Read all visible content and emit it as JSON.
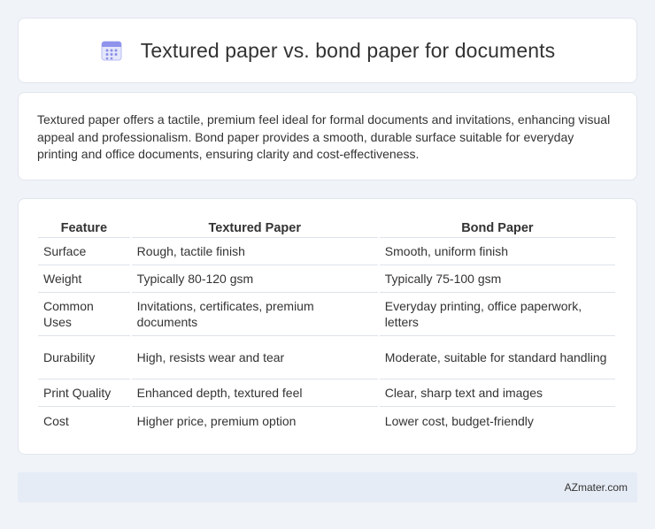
{
  "header": {
    "icon": "calendar-icon",
    "title": "Textured paper vs. bond paper for documents"
  },
  "summary": {
    "text": "Textured paper offers a tactile, premium feel ideal for formal documents and invitations, enhancing visual appeal and professionalism. Bond paper provides a smooth, durable surface suitable for everyday printing and office documents, ensuring clarity and cost-effectiveness."
  },
  "table": {
    "headers": [
      "Feature",
      "Textured Paper",
      "Bond Paper"
    ],
    "rows": [
      [
        "Surface",
        "Rough, tactile finish",
        "Smooth, uniform finish"
      ],
      [
        "Weight",
        "Typically 80-120 gsm",
        "Typically 75-100 gsm"
      ],
      [
        "Common Uses",
        "Invitations, certificates, premium documents",
        "Everyday printing, office paperwork, letters"
      ],
      [
        "Durability",
        "High, resists wear and tear",
        "Moderate, suitable for standard handling"
      ],
      [
        "Print Quality",
        "Enhanced depth, textured feel",
        "Clear, sharp text and images"
      ],
      [
        "Cost",
        "Higher price, premium option",
        "Lower cost, budget-friendly"
      ]
    ]
  },
  "footer": {
    "brand": "AZmater.com"
  },
  "colors": {
    "background": "#f0f3f8",
    "card": "#ffffff",
    "footer_bg": "#e6ecf6",
    "icon_accent": "#7b7fe0"
  }
}
